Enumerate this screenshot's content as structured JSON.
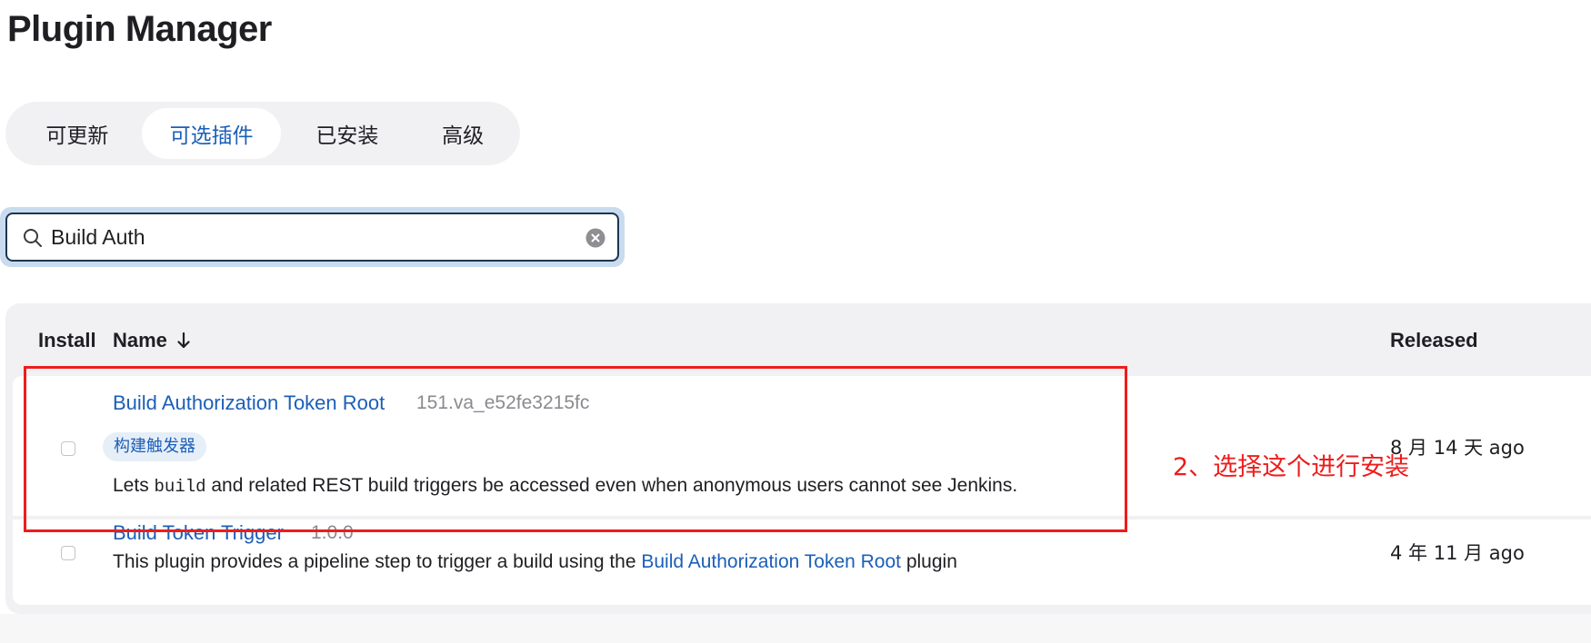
{
  "page": {
    "title": "Plugin Manager"
  },
  "tabs": [
    {
      "label": "可更新",
      "active": false
    },
    {
      "label": "可选插件",
      "active": true
    },
    {
      "label": "已安装",
      "active": false
    },
    {
      "label": "高级",
      "active": false
    }
  ],
  "search": {
    "value": "Build Auth",
    "icon": "search-icon",
    "clear_icon": "clear-icon"
  },
  "table": {
    "headers": {
      "install": "Install",
      "name": "Name",
      "released": "Released"
    },
    "sort_icon": "arrow-down-icon",
    "rows": [
      {
        "name": "Build Authorization Token Root",
        "version": "151.va_e52fe3215fc",
        "tag": "构建触发器",
        "desc_prefix": "Lets ",
        "desc_code": "build",
        "desc_suffix": " and related REST build triggers be accessed even when anonymous users cannot see Jenkins.",
        "released": "8 月 14 天 ago",
        "checked": false
      },
      {
        "name": "Build Token Trigger",
        "version": "1.0.0",
        "desc_prefix": "This plugin provides a pipeline step to trigger a build using the ",
        "desc_link": "Build Authorization Token Root",
        "desc_suffix": " plugin",
        "released": "4 年 11 月 ago",
        "checked": false
      }
    ]
  },
  "annotation": {
    "text": "2、选择这个进行安装",
    "color": "#ee1c1c"
  },
  "colors": {
    "accent": "#1b5fb8",
    "tab_bg": "#f1f1f3",
    "search_border": "#1c3550"
  }
}
